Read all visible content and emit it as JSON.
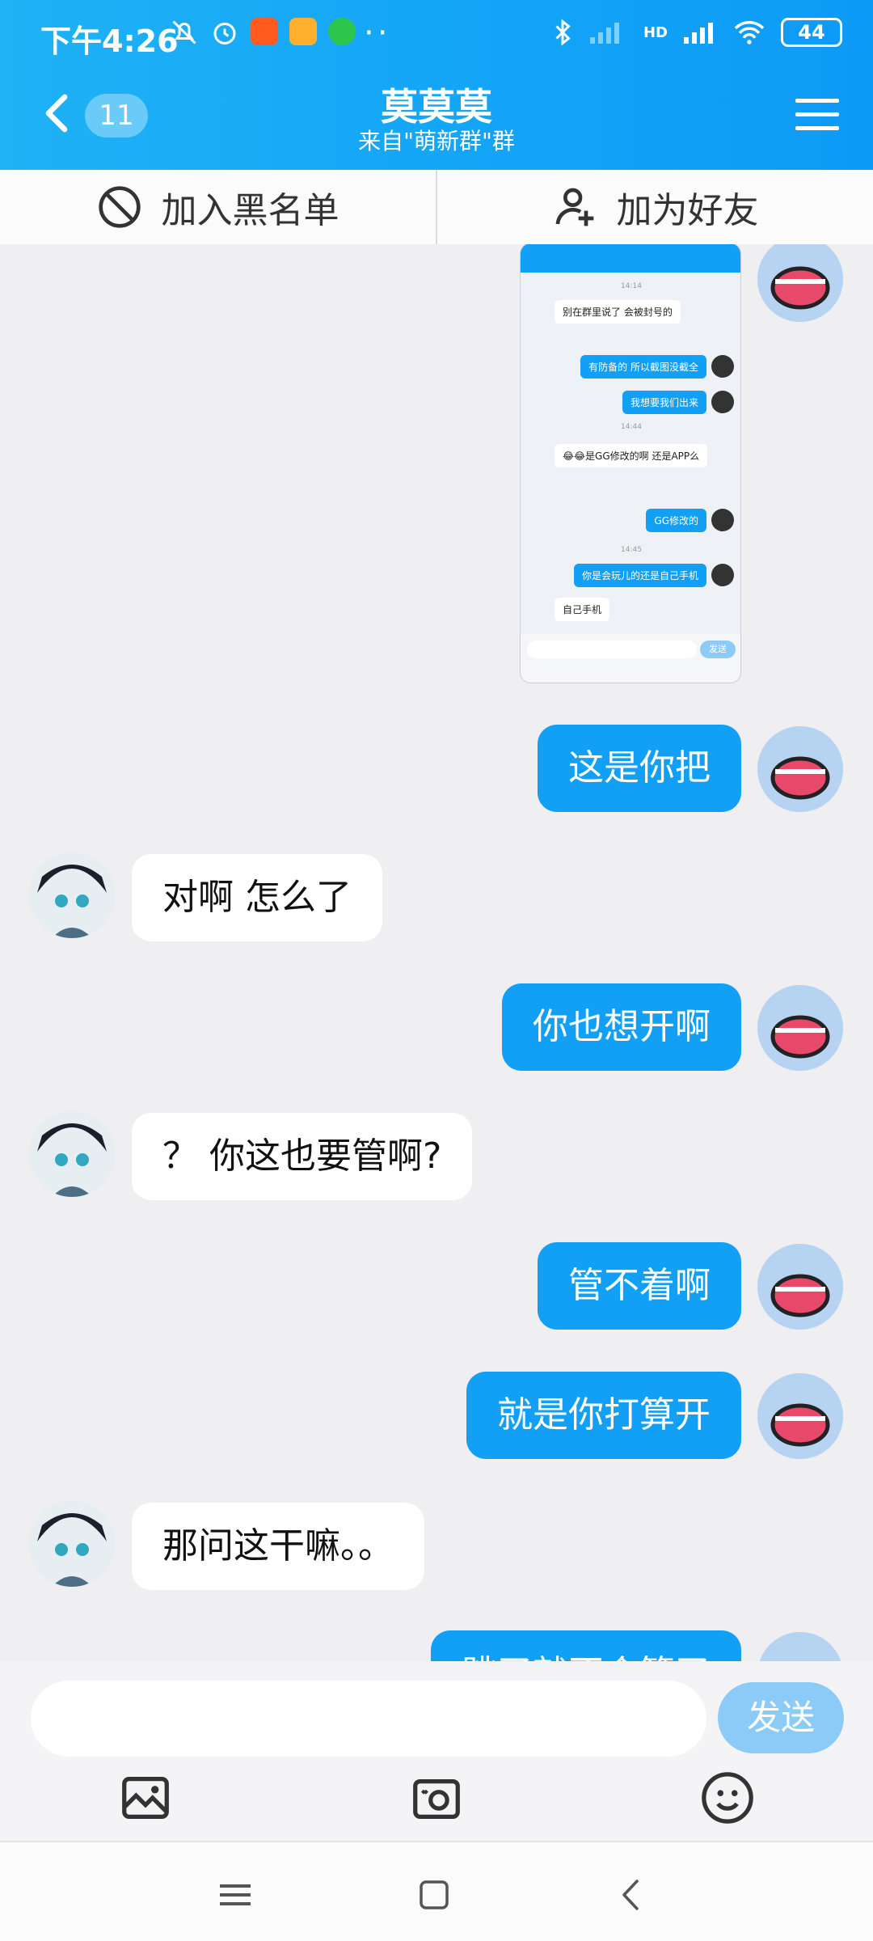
{
  "status_bar": {
    "time": "下午4:26",
    "dots": "··",
    "battery": "44",
    "network": "HD"
  },
  "header": {
    "unread_count": "11",
    "title": "莫莫莫",
    "subtitle": "来自\"萌新群\"群"
  },
  "actions": {
    "blacklist": "加入黑名单",
    "add_friend": "加为好友"
  },
  "screenshot_preview": {
    "times": [
      "14:14",
      "14:44",
      "14:45"
    ],
    "messages": [
      {
        "side": "l",
        "text": "别在群里说了 会被封号的"
      },
      {
        "side": "r",
        "text": "有防备的 所以截图没截全"
      },
      {
        "side": "r",
        "text": "我想要我们出来"
      },
      {
        "side": "l",
        "text": "😂😂是GG修改的啊  还是APP么"
      },
      {
        "side": "r",
        "text": "GG修改的"
      },
      {
        "side": "r",
        "text": "你是会玩儿的还是自己手机"
      },
      {
        "side": "l",
        "text": "自己手机"
      }
    ],
    "send_label": "发送"
  },
  "messages": [
    {
      "side": "me",
      "text": "这是你把"
    },
    {
      "side": "them",
      "text": "对啊 怎么了"
    },
    {
      "side": "me",
      "text": "你也想开啊"
    },
    {
      "side": "them",
      "text": "？ 你这也要管啊?"
    },
    {
      "side": "me",
      "text": "管不着啊"
    },
    {
      "side": "me",
      "text": "就是你打算开"
    },
    {
      "side": "them",
      "text": "那问这干嘛。。"
    },
    {
      "side": "me",
      "text": "跳了就不会管了"
    }
  ],
  "composer": {
    "placeholder": "",
    "send_label": "发送"
  },
  "icons": {
    "back": "chevron-left-icon",
    "menu": "hamburger-icon",
    "blacklist": "block-icon",
    "add_friend": "add-user-icon",
    "image": "image-icon",
    "camera": "camera-icon",
    "emoji": "emoji-icon"
  },
  "colors": {
    "accent": "#12a0f6",
    "send_disabled": "#8ccbf7",
    "background": "#efeff1"
  }
}
